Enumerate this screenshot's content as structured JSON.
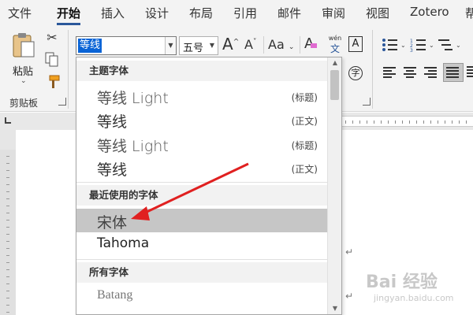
{
  "menu": {
    "tabs": [
      "文件",
      "开始",
      "插入",
      "设计",
      "布局",
      "引用",
      "邮件",
      "审阅",
      "视图",
      "Zotero",
      "帮"
    ]
  },
  "ribbon": {
    "clipboard": {
      "paste_label": "粘贴",
      "group_label": "剪贴板"
    },
    "font": {
      "font_name": "等线",
      "font_size": "五号",
      "grow_label": "A",
      "shrink_label": "A",
      "case_label": "Aa",
      "clear_label": "A",
      "phonetic_top": "wén",
      "phonetic_bottom": "文",
      "border_label": "A",
      "enclose_label": "字"
    }
  },
  "dropdown": {
    "theme_header": "主题字体",
    "recent_header": "最近使用的字体",
    "all_header": "所有字体",
    "theme_fonts": [
      {
        "name": "等线 Light",
        "tag": "(标题)"
      },
      {
        "name": "等线",
        "tag": "(正文)"
      }
    ],
    "theme_fonts_2": [
      {
        "name": "等线 Light",
        "tag": "(标题)"
      },
      {
        "name": "等线",
        "tag": "(正文)"
      }
    ],
    "recent_fonts": [
      "宋体",
      "Tahoma"
    ],
    "all_fonts": [
      "Batang"
    ]
  },
  "document": {
    "paragraph_mark": "↵"
  },
  "watermark": {
    "brand": "Bai 经验",
    "url": "jingyan.baidu.com"
  },
  "colors": {
    "accent": "#2b579a",
    "selection": "#0a64d6",
    "highlight": "#c6c6c6",
    "annotation_arrow": "#e02020"
  }
}
